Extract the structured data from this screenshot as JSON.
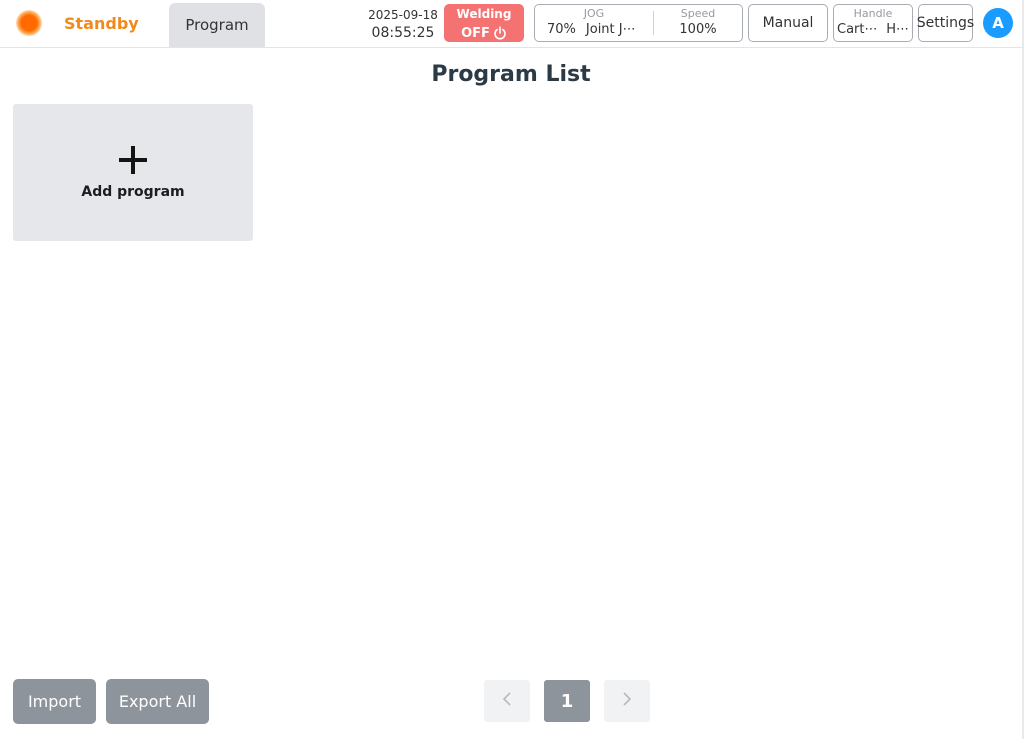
{
  "header": {
    "status": "Standby",
    "tab_program": "Program",
    "date": "2025-09-18",
    "time": "08:55:25",
    "welding": {
      "label": "Welding",
      "state": "OFF"
    },
    "jog": {
      "title": "JOG",
      "percent": "70%",
      "mode": "Joint J⋯"
    },
    "speed": {
      "title": "Speed",
      "value": "100%"
    },
    "manual": "Manual",
    "handle": {
      "title": "Handle",
      "left": "Cart⋯",
      "right": "H⋯"
    },
    "settings": "Settings",
    "avatar": "A"
  },
  "main": {
    "title": "Program List",
    "add_program": "Add program"
  },
  "footer": {
    "import": "Import",
    "export_all": "Export All",
    "current_page": "1"
  },
  "colors": {
    "status_orange": "#f08a1c",
    "welding_off": "#f57272",
    "avatar_blue": "#1a9bff",
    "button_gray": "#8e949c"
  },
  "icons": [
    "status-indicator-icon",
    "power-icon",
    "plus-icon",
    "chevron-left-icon",
    "chevron-right-icon"
  ]
}
